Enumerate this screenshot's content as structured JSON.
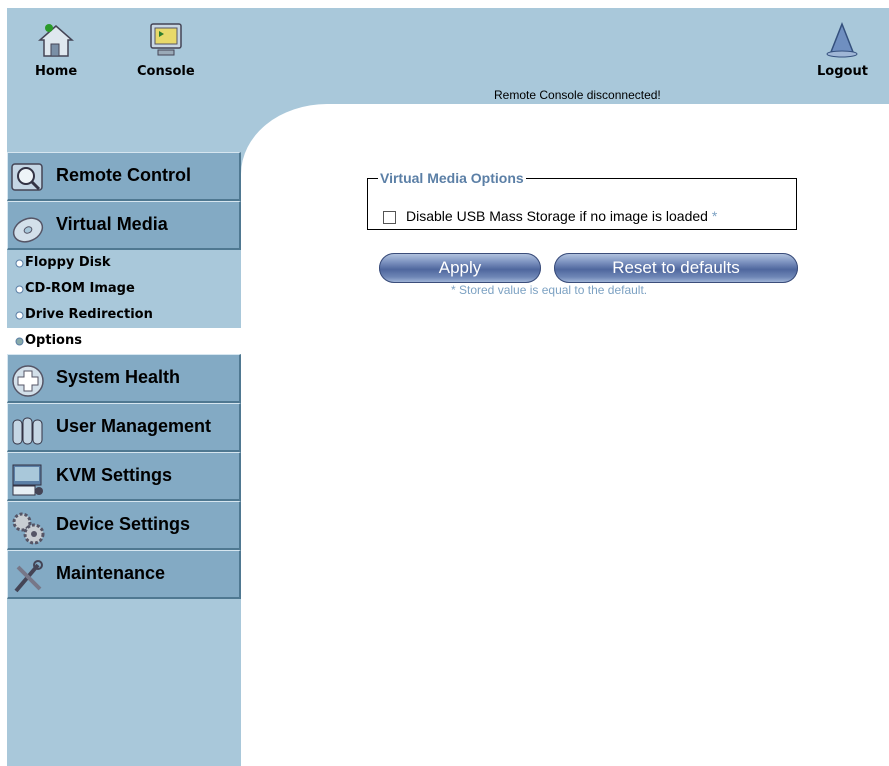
{
  "header": {
    "home_label": "Home",
    "console_label": "Console",
    "logout_label": "Logout",
    "status_text": "Remote Console disconnected!"
  },
  "sidebar": {
    "sections": [
      {
        "label": "Remote Control",
        "icon": "monitor-magnifier-icon"
      },
      {
        "label": "Virtual Media",
        "icon": "disc-icon"
      },
      {
        "label": "System Health",
        "icon": "health-cross-icon"
      },
      {
        "label": "User Management",
        "icon": "users-icon"
      },
      {
        "label": "KVM Settings",
        "icon": "keyboard-monitor-icon"
      },
      {
        "label": "Device Settings",
        "icon": "gears-icon"
      },
      {
        "label": "Maintenance",
        "icon": "tools-icon"
      }
    ],
    "virtual_media_items": [
      "Floppy Disk",
      "CD-ROM Image",
      "Drive Redirection",
      "Options"
    ],
    "active_item": "Options"
  },
  "main": {
    "fieldset_title": "Virtual Media Options",
    "checkbox_label": "Disable USB Mass Storage if no image is loaded",
    "checkbox_checked": false,
    "asterisk": "*",
    "apply_label": "Apply",
    "reset_label": "Reset to defaults",
    "note": "* Stored value is equal to the default."
  },
  "colors": {
    "frame_bg": "#a9c8da",
    "section_bg": "#83aac4",
    "legend_color": "#5b7fa6",
    "note_color": "#7da2c3"
  }
}
